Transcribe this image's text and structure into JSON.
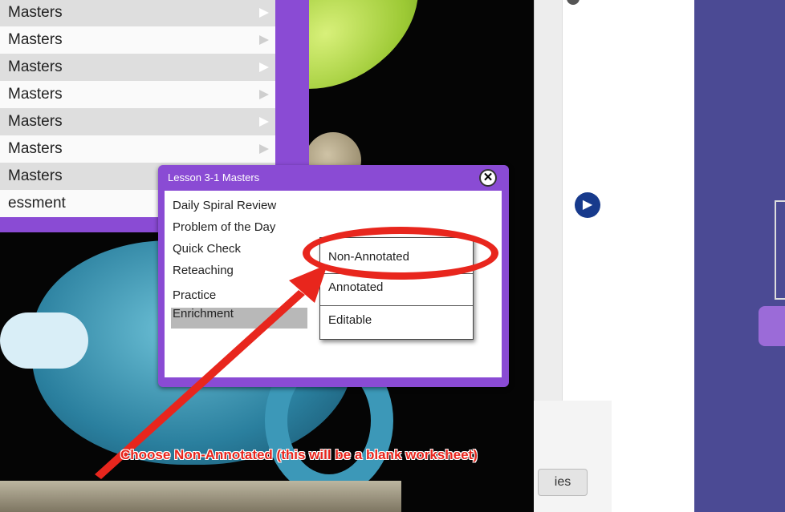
{
  "masters_list": {
    "rows": [
      {
        "label": "Masters"
      },
      {
        "label": "Masters"
      },
      {
        "label": "Masters"
      },
      {
        "label": "Masters"
      },
      {
        "label": "Masters"
      },
      {
        "label": "Masters"
      },
      {
        "label": "Masters"
      },
      {
        "label": "essment"
      }
    ]
  },
  "popup": {
    "title": "Lesson 3-1 Masters",
    "close_icon": "close-icon",
    "items": [
      {
        "label": "Daily Spiral Review"
      },
      {
        "label": "Problem of the Day"
      },
      {
        "label": "Quick Check"
      },
      {
        "label": "Reteaching"
      },
      {
        "label": "Practice"
      },
      {
        "label": "Enrichment"
      }
    ],
    "selected_item": "Practice"
  },
  "submenu": {
    "items": [
      {
        "label": "Non-Annotated"
      },
      {
        "label": "Annotated"
      },
      {
        "label": "Editable"
      }
    ]
  },
  "side_panel": {
    "next_icon": "play-circle-icon",
    "tab_label": "ies"
  },
  "annotation": {
    "caption": "Choose Non-Annotated (this will be a blank worksheet)",
    "color": "#e8261d"
  },
  "colors": {
    "purple": "#8a4bd4",
    "navy": "#4b4a94"
  }
}
